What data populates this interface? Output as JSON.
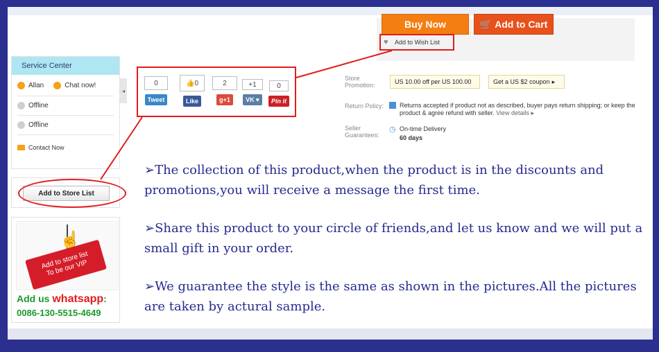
{
  "buttons": {
    "buy_now": "Buy Now",
    "add_to_cart": "Add to Cart",
    "add_to_wish_list": "Add to Wish List",
    "add_to_store_list": "Add to Store List"
  },
  "service_center": {
    "title": "Service Center",
    "rows": [
      {
        "status": "online",
        "label": "Allan"
      },
      {
        "status": "online",
        "label": "Chat now!"
      },
      {
        "status": "offline",
        "label": "Offline"
      },
      {
        "status": "offline",
        "label": "Offline"
      }
    ],
    "contact": "Contact Now"
  },
  "social": [
    {
      "count": "0",
      "label": "Tweet",
      "color": "#3a86c8"
    },
    {
      "count": "0",
      "label": "Like",
      "color": "#3b5998"
    },
    {
      "count": "2",
      "label": "g+1",
      "color": "#dd4b39"
    },
    {
      "count": "+1",
      "label": "VK",
      "color": "#5b7fa6"
    },
    {
      "count": "0",
      "label": "Pin it",
      "color": "#cb2027"
    }
  ],
  "store_info": {
    "promotion_label": "Store Promotion:",
    "coupon1": "US 10.00 off per US 100.00",
    "coupon2": "Get a US $2 coupon",
    "return_label": "Return Policy:",
    "return_text": "Returns accepted if product not as described, buyer pays return shipping; or keep the product & agree refund with seller.",
    "view_details": "View details",
    "guarantee_label": "Seller Guarantees:",
    "delivery": "On-time Delivery",
    "days": "60 days"
  },
  "promo_card": {
    "tag_line1": "Add to store list",
    "tag_line2": "To be our VIP",
    "whatsapp_prefix": "Add us",
    "whatsapp": "whatsapp",
    "whatsapp_suffix": ":",
    "phone": "0086-130-5515-4649"
  },
  "messages": [
    "➢The collection of this product,when the product is in the discounts and promotions,you will receive a message the first time.",
    "➢Share this product to your circle of friends,and let us know and we will put a small gift in your order.",
    "➢We guarantee the style is the same as shown in the pictures.All the pictures are taken by actural sample."
  ],
  "colors": {
    "border": "#2b2f8f",
    "highlight": "#e21b1b",
    "text": "#252a8e",
    "buy": "#f47e12",
    "cart": "#e8511a"
  }
}
